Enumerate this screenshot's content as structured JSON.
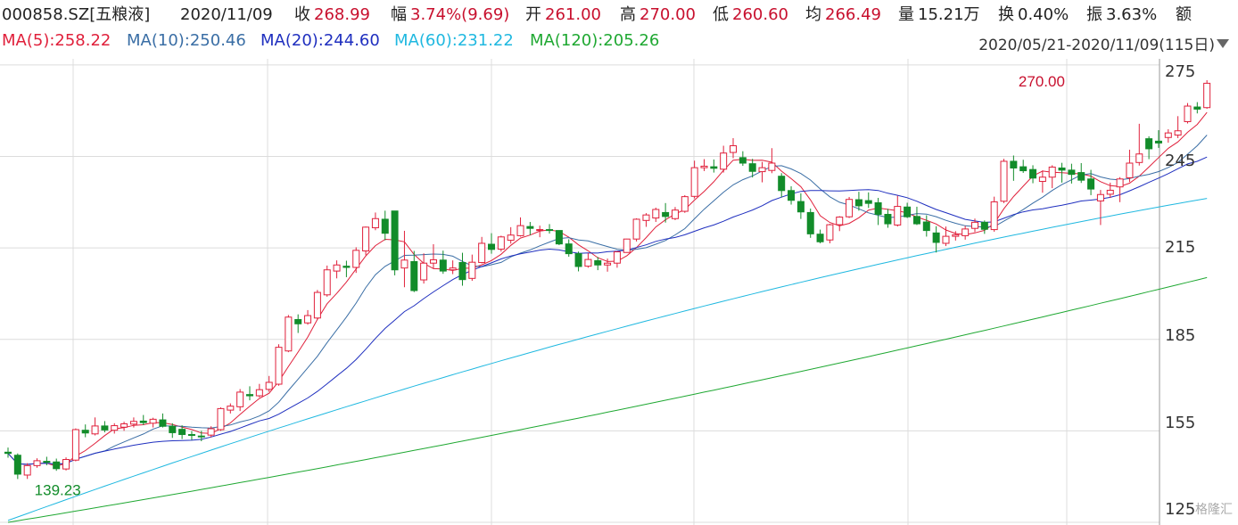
{
  "header": {
    "code": "000858.SZ[五粮液]",
    "date": "2020/11/09",
    "close_label": "收",
    "close_value": "268.99",
    "amp_label": "幅",
    "amp_value": "3.74%(9.69)",
    "open_label": "开",
    "open_value": "261.00",
    "high_label": "高",
    "high_value": "270.00",
    "low_label": "低",
    "low_value": "260.60",
    "avg_label": "均",
    "avg_value": "266.49",
    "vol_label": "量",
    "vol_value": "15.21万",
    "turn_label": "换",
    "turn_value": "0.40%",
    "swing_label": "振",
    "swing_value": "3.63%",
    "amount_label": "额"
  },
  "ma_legend": [
    {
      "text": "MA(5):258.22",
      "color": "#e0203b"
    },
    {
      "text": "MA(10):250.46",
      "color": "#3a6ea5"
    },
    {
      "text": "MA(20):244.60",
      "color": "#1f2fbf"
    },
    {
      "text": "MA(60):231.22",
      "color": "#1fb8e0"
    },
    {
      "text": "MA(120):205.26",
      "color": "#1fa832"
    }
  ],
  "range": "2020/05/21-2020/11/09(115日)",
  "watermark": "格隆汇",
  "colors": {
    "up": "#e0203b",
    "down": "#128c2a",
    "grid": "#dcdcdc"
  },
  "chart_data": {
    "type": "candlestick",
    "ylim": [
      125,
      277
    ],
    "y_ticks": [
      "275",
      "245",
      "215",
      "185",
      "155",
      "125"
    ],
    "annotations": [
      {
        "text": "270.00",
        "series_index": 113,
        "value": 270.0,
        "color": "#c8102e"
      },
      {
        "text": "139.23",
        "series_index": 2,
        "value": 139.23,
        "color": "#128c2a"
      }
    ],
    "ohlc": [
      [
        148.0,
        149.5,
        146.2,
        147.6
      ],
      [
        147.0,
        147.6,
        139.2,
        140.8
      ],
      [
        140.5,
        144.4,
        139.23,
        143.6
      ],
      [
        143.6,
        146.0,
        142.9,
        145.2
      ],
      [
        145.0,
        146.5,
        143.7,
        144.8
      ],
      [
        144.8,
        145.9,
        141.9,
        142.6
      ],
      [
        142.5,
        146.3,
        142.0,
        145.6
      ],
      [
        145.4,
        155.8,
        145.0,
        155.4
      ],
      [
        155.2,
        157.1,
        152.9,
        154.3
      ],
      [
        154.0,
        159.4,
        153.5,
        156.6
      ],
      [
        156.6,
        158.2,
        154.5,
        155.3
      ],
      [
        155.2,
        157.5,
        154.1,
        156.7
      ],
      [
        156.2,
        158.0,
        155.0,
        157.3
      ],
      [
        157.2,
        159.4,
        156.1,
        158.1
      ],
      [
        158.2,
        160.2,
        156.9,
        157.7
      ],
      [
        157.5,
        159.3,
        156.1,
        158.8
      ],
      [
        158.6,
        160.7,
        156.1,
        156.5
      ],
      [
        156.5,
        157.5,
        152.7,
        154.4
      ],
      [
        155.5,
        156.8,
        152.3,
        153.8
      ],
      [
        153.8,
        154.9,
        152.0,
        153.6
      ],
      [
        153.3,
        155.0,
        151.6,
        153.2
      ],
      [
        153.6,
        156.5,
        152.9,
        155.7
      ],
      [
        155.4,
        162.7,
        155.0,
        162.3
      ],
      [
        161.8,
        164.0,
        160.7,
        163.1
      ],
      [
        162.9,
        168.7,
        161.5,
        167.7
      ],
      [
        166.9,
        169.6,
        165.0,
        166.5
      ],
      [
        166.5,
        170.4,
        166.0,
        168.5
      ],
      [
        168.6,
        173.0,
        167.8,
        170.9
      ],
      [
        170.3,
        183.4,
        169.8,
        182.4
      ],
      [
        181.2,
        193.0,
        180.8,
        192.3
      ],
      [
        191.5,
        193.2,
        187.1,
        190.1
      ],
      [
        190.4,
        194.6,
        189.8,
        192.8
      ],
      [
        192.0,
        201.2,
        191.5,
        200.4
      ],
      [
        199.6,
        209.2,
        199.0,
        207.8
      ],
      [
        207.4,
        210.9,
        205.0,
        209.4
      ],
      [
        209.0,
        210.8,
        205.4,
        208.6
      ],
      [
        208.6,
        215.2,
        206.8,
        214.2
      ],
      [
        214.0,
        222.0,
        212.6,
        221.8
      ],
      [
        221.6,
        226.6,
        220.8,
        224.6
      ],
      [
        224.4,
        227.2,
        217.5,
        219.8
      ],
      [
        227.1,
        227.1,
        206.0,
        207.8
      ],
      [
        208.4,
        220.6,
        202.1,
        211.0
      ],
      [
        210.5,
        214.0,
        200.5,
        201.0
      ],
      [
        204.5,
        213.2,
        203.3,
        210.0
      ],
      [
        210.0,
        216.2,
        208.3,
        211.1
      ],
      [
        211.0,
        214.1,
        206.5,
        207.4
      ],
      [
        207.8,
        210.9,
        206.4,
        208.4
      ],
      [
        210.2,
        213.4,
        202.6,
        204.6
      ],
      [
        205.0,
        212.8,
        204.2,
        210.3
      ],
      [
        210.2,
        218.6,
        209.9,
        216.5
      ],
      [
        216.2,
        219.8,
        213.1,
        214.5
      ],
      [
        214.6,
        219.0,
        213.8,
        218.6
      ],
      [
        217.5,
        221.8,
        216.4,
        219.2
      ],
      [
        219.0,
        225.0,
        218.7,
        222.3
      ],
      [
        222.0,
        223.5,
        219.2,
        221.4
      ],
      [
        220.7,
        222.3,
        218.5,
        221.0
      ],
      [
        221.0,
        222.8,
        219.7,
        220.7
      ],
      [
        220.7,
        220.7,
        215.9,
        216.3
      ],
      [
        216.3,
        217.8,
        212.1,
        213.1
      ],
      [
        213.1,
        213.8,
        207.3,
        208.9
      ],
      [
        209.0,
        213.3,
        208.5,
        211.2
      ],
      [
        210.8,
        212.0,
        207.7,
        209.4
      ],
      [
        209.4,
        211.5,
        207.2,
        210.0
      ],
      [
        210.0,
        213.9,
        208.5,
        213.7
      ],
      [
        213.5,
        218.0,
        213.4,
        217.9
      ],
      [
        217.9,
        224.7,
        217.1,
        224.4
      ],
      [
        224.0,
        226.4,
        221.9,
        225.8
      ],
      [
        224.8,
        228.2,
        223.5,
        227.6
      ],
      [
        226.6,
        229.7,
        223.3,
        225.3
      ],
      [
        224.6,
        228.4,
        224.1,
        227.4
      ],
      [
        227.0,
        232.3,
        226.5,
        231.8
      ],
      [
        231.9,
        243.6,
        231.2,
        241.3
      ],
      [
        241.3,
        244.1,
        240.2,
        241.8
      ],
      [
        241.6,
        244.0,
        239.7,
        241.1
      ],
      [
        240.8,
        248.5,
        239.7,
        246.1
      ],
      [
        246.3,
        251.0,
        244.4,
        248.5
      ],
      [
        244.6,
        246.7,
        241.9,
        242.8
      ],
      [
        242.6,
        244.2,
        238.1,
        240.1
      ],
      [
        240.0,
        243.2,
        236.5,
        241.3
      ],
      [
        240.4,
        247.7,
        239.5,
        242.8
      ],
      [
        238.5,
        239.5,
        231.6,
        233.8
      ],
      [
        233.8,
        235.2,
        229.2,
        230.6
      ],
      [
        230.2,
        232.9,
        224.5,
        226.8
      ],
      [
        226.6,
        227.9,
        218.3,
        219.6
      ],
      [
        219.5,
        221.0,
        216.5,
        217.0
      ],
      [
        217.6,
        222.9,
        216.5,
        222.6
      ],
      [
        222.6,
        225.4,
        220.5,
        225.1
      ],
      [
        225.2,
        231.7,
        224.8,
        230.9
      ],
      [
        230.8,
        233.4,
        227.2,
        228.8
      ],
      [
        230.5,
        233.2,
        228.1,
        229.6
      ],
      [
        229.8,
        231.4,
        222.5,
        226.0
      ],
      [
        226.0,
        227.8,
        221.6,
        222.9
      ],
      [
        222.5,
        232.1,
        222.0,
        228.6
      ],
      [
        228.4,
        229.8,
        224.8,
        225.2
      ],
      [
        225.3,
        228.5,
        222.5,
        222.9
      ],
      [
        223.5,
        225.7,
        218.7,
        220.7
      ],
      [
        219.9,
        222.1,
        213.5,
        216.8
      ],
      [
        216.5,
        222.0,
        215.6,
        218.8
      ],
      [
        218.8,
        220.5,
        217.4,
        219.3
      ],
      [
        219.0,
        222.2,
        217.7,
        221.2
      ],
      [
        221.4,
        224.6,
        220.2,
        223.4
      ],
      [
        223.4,
        224.0,
        219.6,
        221.1
      ],
      [
        221.0,
        231.8,
        220.3,
        230.1
      ],
      [
        230.3,
        244.2,
        229.7,
        243.4
      ],
      [
        243.4,
        245.3,
        237.0,
        241.2
      ],
      [
        241.6,
        243.9,
        239.6,
        240.3
      ],
      [
        240.7,
        242.1,
        236.2,
        237.9
      ],
      [
        236.8,
        240.4,
        233.1,
        238.2
      ],
      [
        238.2,
        242.1,
        234.6,
        241.5
      ],
      [
        241.2,
        242.9,
        236.4,
        240.5
      ],
      [
        240.5,
        242.6,
        236.1,
        239.1
      ],
      [
        239.7,
        242.8,
        236.3,
        237.2
      ],
      [
        237.6,
        240.6,
        232.3,
        234.3
      ],
      [
        230.4,
        234.0,
        222.5,
        232.5
      ],
      [
        232.6,
        236.4,
        231.4,
        233.9
      ],
      [
        235.0,
        238.2,
        230.0,
        237.6
      ],
      [
        238.0,
        247.2,
        236.6,
        242.8
      ],
      [
        243.0,
        255.7,
        242.0,
        245.8
      ],
      [
        250.8,
        251.6,
        244.1,
        247.5
      ],
      [
        250.0,
        253.6,
        247.8,
        249.4
      ],
      [
        251.2,
        253.9,
        249.5,
        252.7
      ],
      [
        252.0,
        258.2,
        251.0,
        253.4
      ],
      [
        256.4,
        262.5,
        255.8,
        261.5
      ],
      [
        261.2,
        262.8,
        259.1,
        260.5
      ],
      [
        261.0,
        270.0,
        260.6,
        268.99
      ]
    ]
  }
}
